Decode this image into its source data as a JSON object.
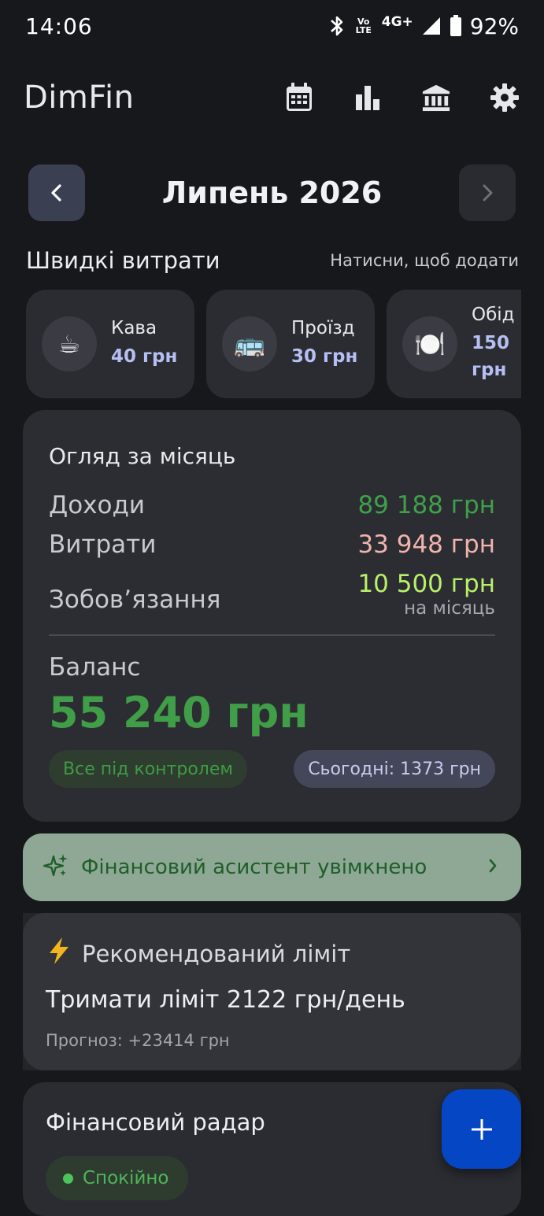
{
  "status_bar": {
    "time": "14:06",
    "volte_line1": "Vo",
    "volte_line2": "LTE",
    "network": "4G+",
    "battery": "92%"
  },
  "app_bar": {
    "title": "DimFin",
    "actions": [
      "calendar-icon",
      "bar-chart-icon",
      "bank-icon",
      "settings-icon"
    ]
  },
  "month_nav": {
    "title": "Липень 2026"
  },
  "quick_expenses": {
    "title": "Швидкі витрати",
    "hint": "Натисни, щоб додати",
    "items": [
      {
        "emoji": "☕",
        "name": "Кава",
        "amount": "40 грн"
      },
      {
        "emoji": "🚌",
        "name": "Проїзд",
        "amount": "30 грн"
      },
      {
        "emoji": "🍽️",
        "name": "Обід",
        "amount": "150 грн"
      }
    ]
  },
  "overview": {
    "title": "Огляд за місяць",
    "income_label": "Доходи",
    "income_value": "89 188 грн",
    "expenses_label": "Витрати",
    "expenses_value": "33 948 грн",
    "obligations_label": "Зобов’язання",
    "obligations_value": "10 500 грн",
    "obligations_sub": "на місяць",
    "balance_label": "Баланс",
    "balance_value": "55 240 грн",
    "status_chip": "Все під контролем",
    "today_chip": "Сьогодні: 1373 грн"
  },
  "assistant": {
    "label": "Фінансовий асистент увімкнено"
  },
  "limit": {
    "title": "Рекомендований ліміт",
    "main": "Тримати ліміт 2122 грн/день",
    "forecast": "Прогноз: +23414 грн"
  },
  "radar": {
    "title": "Фінансовий радар",
    "status": "Спокійно"
  },
  "colors": {
    "background": "#17181c",
    "card": "#2c2d32",
    "income": "#3fa04a",
    "expenses": "#f0b4ad",
    "obligations": "#b9f06a",
    "accent": "#b6bff3",
    "assistant_bg": "#8fa895",
    "fab": "#0546c4"
  }
}
